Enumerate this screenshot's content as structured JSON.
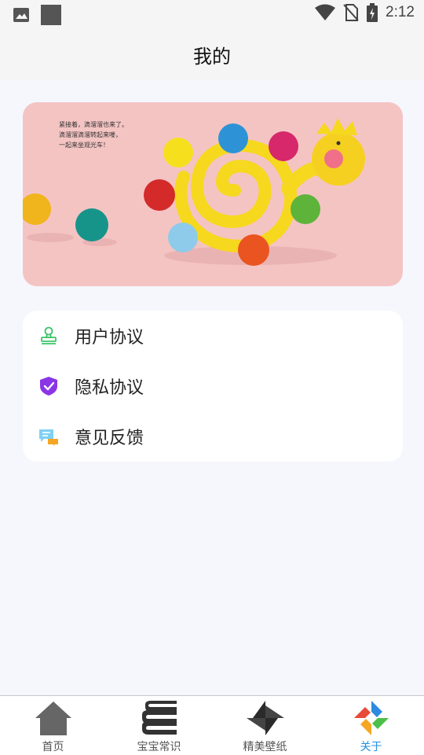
{
  "status_bar": {
    "time": "2:12",
    "icons": [
      "image-icon",
      "square-icon",
      "wifi-icon",
      "no-sim-icon",
      "battery-charging-icon"
    ]
  },
  "header": {
    "title": "我的"
  },
  "banner": {
    "lines": [
      "紧接着，滴溜溜也来了。",
      "滴溜溜滴溜转起来喽，",
      "一起来坐观光车！"
    ]
  },
  "menu": {
    "items": [
      {
        "label": "用户协议",
        "icon": "stamp-icon"
      },
      {
        "label": "隐私协议",
        "icon": "shield-check-icon"
      },
      {
        "label": "意见反馈",
        "icon": "feedback-icon"
      }
    ]
  },
  "tabbar": {
    "tabs": [
      {
        "label": "首页",
        "icon": "home-icon"
      },
      {
        "label": "宝宝常识",
        "icon": "books-icon"
      },
      {
        "label": "精美壁纸",
        "icon": "pinwheel-icon"
      },
      {
        "label": "关于",
        "icon": "about-icon"
      }
    ],
    "active": "关于",
    "colors": {
      "active": "#1f8fe0",
      "inactive": "#555555"
    }
  }
}
